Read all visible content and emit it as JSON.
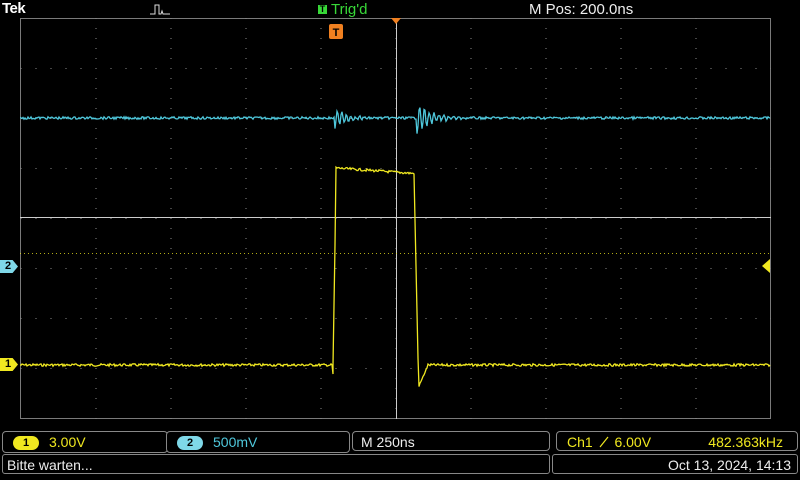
{
  "header": {
    "brand": "Tek",
    "acquisition_icon": "pulse-acquisition-icon",
    "trigger_status": "Trig'd",
    "trigger_glyph": "T",
    "horizontal_position": "M Pos: 200.0ns"
  },
  "markers": {
    "ch1": "1",
    "ch2": "2",
    "trigger_position_icon": "trigger-position-icon",
    "trigger_level_icon": "trigger-level-arrow-icon"
  },
  "colors": {
    "ch1": "#f0e820",
    "ch2": "#4fc8dc",
    "grid": "#7a7a7a",
    "trigger": "#f08020",
    "trig_status": "#38d838"
  },
  "footer": {
    "ch1_label": "1",
    "ch1_scale": "3.00V",
    "ch2_label": "2",
    "ch2_scale": "500mV",
    "time_scale": "M 250ns",
    "trigger_source": "Ch1",
    "trigger_slope_icon": "rising-edge-icon",
    "trigger_level": "6.00V",
    "frequency": "482.363kHz"
  },
  "status": {
    "message": "Bitte warten...",
    "datetime": "Oct 13, 2024, 14:13"
  }
}
